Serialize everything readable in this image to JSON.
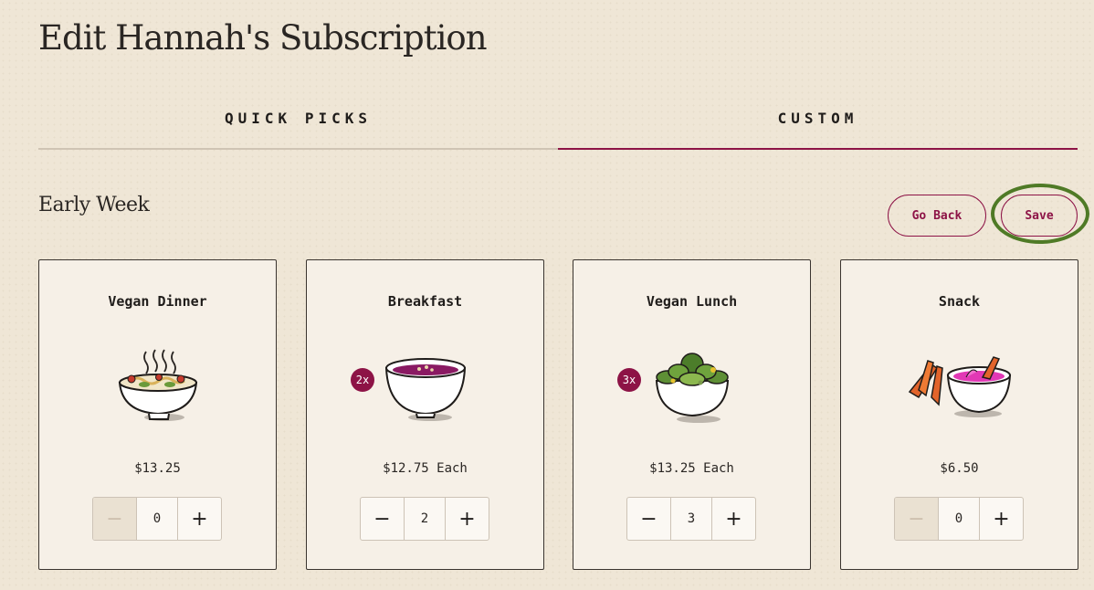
{
  "page": {
    "title": "Edit Hannah's Subscription"
  },
  "tabs": [
    {
      "label": "QUICK PICKS",
      "active": false
    },
    {
      "label": "CUSTOM",
      "active": true
    }
  ],
  "section": {
    "title": "Early Week",
    "go_back_label": "Go Back",
    "save_label": "Save"
  },
  "colors": {
    "accent": "#8d1346",
    "background": "#efe6d6",
    "card_background": "#f6f0e7",
    "highlight_ring": "#4f7a26"
  },
  "meals": [
    {
      "name": "Vegan Dinner",
      "icon": "noodle-bowl-icon",
      "price": "$13.25",
      "quantity": "0",
      "badge": "",
      "minus": "−",
      "plus": "+"
    },
    {
      "name": "Breakfast",
      "icon": "smoothie-bowl-icon",
      "price": "$12.75 Each",
      "quantity": "2",
      "badge": "2x",
      "minus": "−",
      "plus": "+"
    },
    {
      "name": "Vegan Lunch",
      "icon": "salad-bowl-icon",
      "price": "$13.25 Each",
      "quantity": "3",
      "badge": "3x",
      "minus": "−",
      "plus": "+"
    },
    {
      "name": "Snack",
      "icon": "dip-with-veggies-icon",
      "price": "$6.50",
      "quantity": "0",
      "badge": "",
      "minus": "−",
      "plus": "+"
    }
  ]
}
